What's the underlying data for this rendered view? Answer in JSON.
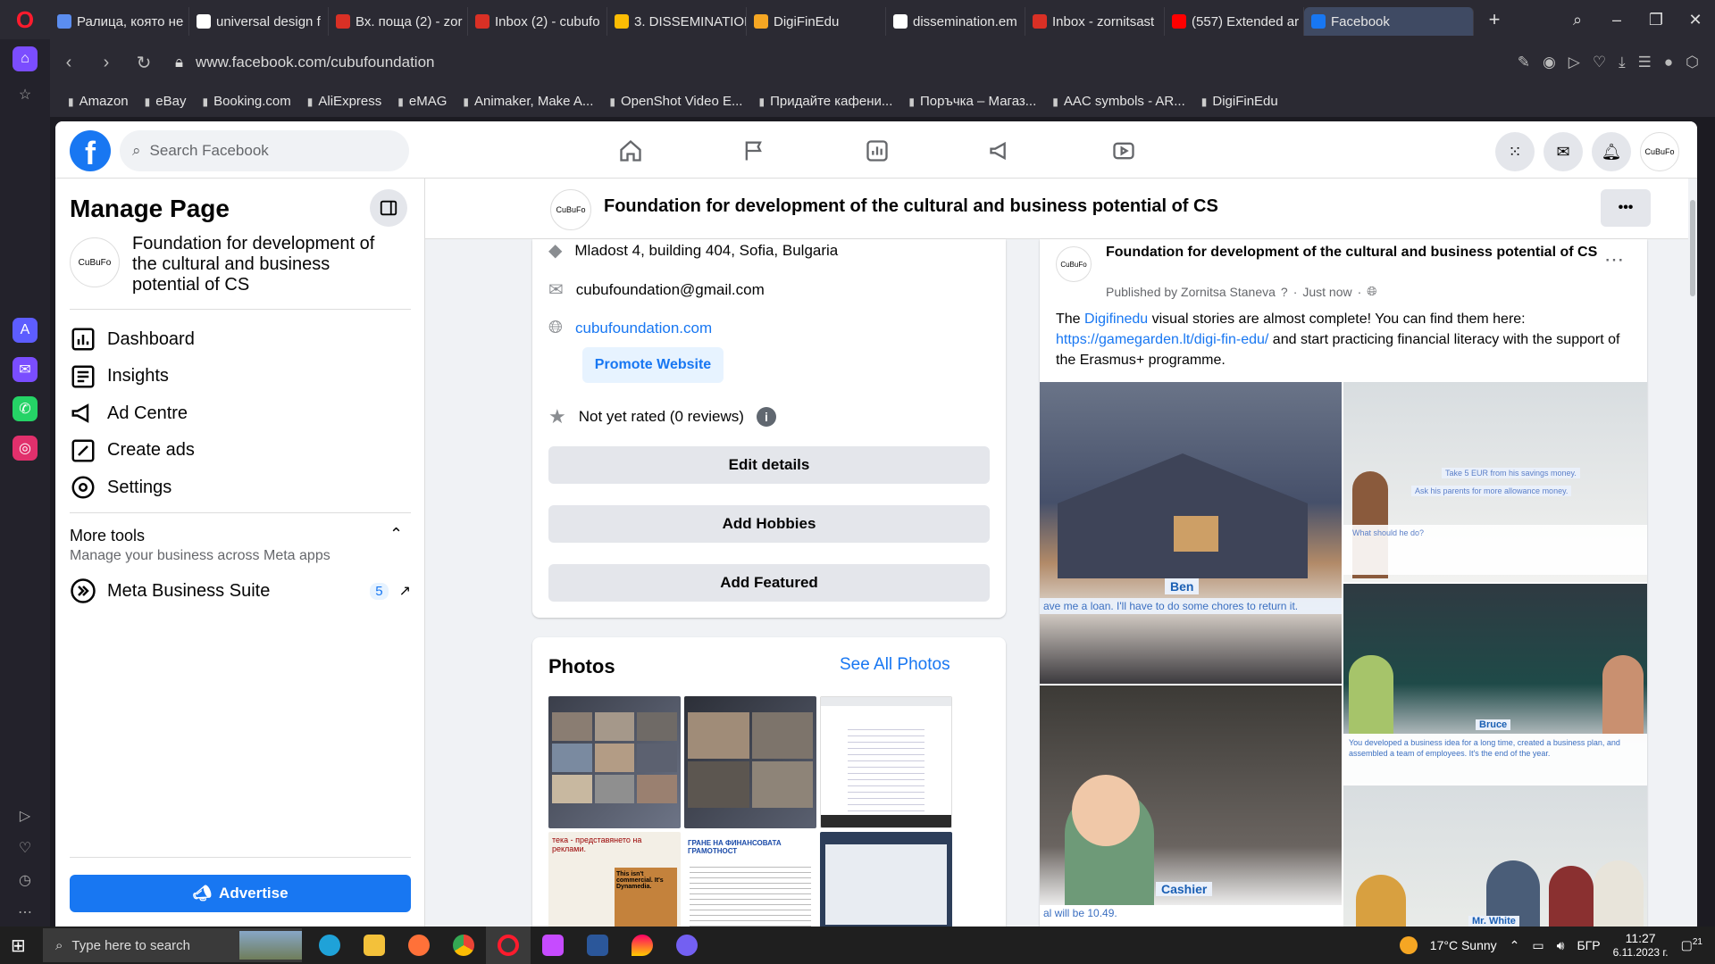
{
  "browser": {
    "tabs": [
      {
        "title": "Ралица, която не",
        "color": "#5b8def"
      },
      {
        "title": "universal design f",
        "color": "#ffffff"
      },
      {
        "title": "Вх. поща (2) - zor",
        "color": "#d93025"
      },
      {
        "title": "Inbox (2) - cubufo",
        "color": "#d93025"
      },
      {
        "title": "3. DISSEMINATION",
        "color": "#fbbc04"
      },
      {
        "title": "DigiFinEdu",
        "color": "#f5a623"
      },
      {
        "title": "dissemination.em",
        "color": "#ffffff"
      },
      {
        "title": "Inbox - zornitsast",
        "color": "#d93025"
      },
      {
        "title": "(557) Extended ar",
        "color": "#ff0000"
      },
      {
        "title": "Facebook",
        "color": "#1877f2"
      }
    ],
    "url": "www.facebook.com/cubufoundation",
    "bookmarks": [
      "Amazon",
      "eBay",
      "Booking.com",
      "AliExpress",
      "eMAG",
      "Animaker, Make A...",
      "OpenShot Video E...",
      "Придайте кафени...",
      "Поръчка – Магаз...",
      "AAC symbols - AR...",
      "DigiFinEdu"
    ]
  },
  "facebook": {
    "search_placeholder": "Search Facebook",
    "logo": "f"
  },
  "manage": {
    "title": "Manage Page",
    "page_name": "Foundation for development of the cultural and business potential of CS",
    "avatar_text": "CuBuFo",
    "menu": [
      {
        "label": "Dashboard",
        "icon": "dashboard-icon"
      },
      {
        "label": "Insights",
        "icon": "insights-icon"
      },
      {
        "label": "Ad Centre",
        "icon": "megaphone-icon"
      },
      {
        "label": "Create ads",
        "icon": "edit-icon"
      },
      {
        "label": "Settings",
        "icon": "gear-icon"
      }
    ],
    "more_tools": "More tools",
    "more_tools_sub": "Manage your business across Meta apps",
    "mbs": "Meta Business Suite",
    "mbs_badge": "5",
    "advertise": "Advertise"
  },
  "header": {
    "title": "Foundation for development of the cultural and business potential of CS",
    "more": "•••"
  },
  "intro": {
    "address": "Mladost 4, building 404, Sofia, Bulgaria",
    "email": "cubufoundation@gmail.com",
    "website": "cubufoundation.com",
    "promote": "Promote Website",
    "rating": "Not yet rated (0 reviews)",
    "edit": "Edit details",
    "hobbies": "Add Hobbies",
    "featured": "Add Featured"
  },
  "photos": {
    "title": "Photos",
    "see_all": "See All Photos",
    "overlay_1": "тека - представянето на реклами.",
    "overlay_2": "This isn't commercial. It's Dynamedia.",
    "overlay_3": "ГРАНЕ НА ФИНАНСОВАТА ГРАМОТНОСТ"
  },
  "post": {
    "author": "Foundation for development of the cultural and business potential of CS",
    "published_by": "Published by Zornitsa Staneva",
    "time": "Just now",
    "text_before": "The ",
    "link1": "Digifinedu",
    "text_mid": " visual stories are almost complete! You can find them here: ",
    "link2": "https://gamegarden.lt/digi-fin-edu/",
    "text_after": " and start practicing financial literacy with the support of the Erasmus+ programme.",
    "img1_name": "Ben",
    "img1_caption": "ave me a loan. I'll have to do some chores to return it.",
    "img2_line1": "Take 5 EUR from his savings money.",
    "img2_line2": "Ask his parents for more allowance money.",
    "img2_line3": "What should he do?",
    "img3_name": "Bruce",
    "img3_caption": "You developed a business idea for a long time, created a business plan, and assembled a team of employees. It's the end of the year.",
    "img4_name": "Cashier",
    "img4_caption": "al will be 10.49.",
    "img5_name": "Mr. White"
  },
  "taskbar": {
    "search": "Type here to search",
    "weather": "17°C  Sunny",
    "lang": "БГР",
    "time": "11:27",
    "date": "6.11.2023 г.",
    "notif": "21"
  }
}
